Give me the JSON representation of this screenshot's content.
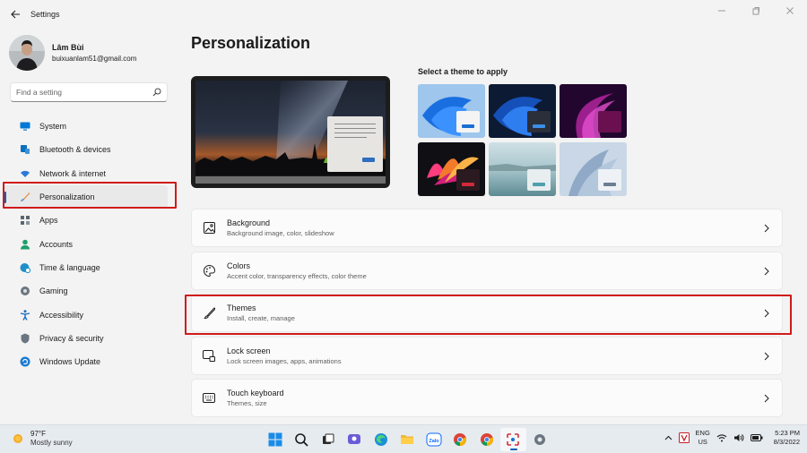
{
  "window": {
    "title": "Settings",
    "back_icon": "back-arrow-icon"
  },
  "profile": {
    "name": "Lâm Bùi",
    "email": "buixuanlam51@gmail.com"
  },
  "search": {
    "placeholder": "Find a setting",
    "icon": "search-icon"
  },
  "sidebar": {
    "items": [
      {
        "label": "System",
        "icon": "system-icon",
        "color": "#0078d4"
      },
      {
        "label": "Bluetooth & devices",
        "icon": "bluetooth-icon",
        "color": "#0a6fbd"
      },
      {
        "label": "Network & internet",
        "icon": "wifi-icon",
        "color": "#2a7ad8"
      },
      {
        "label": "Personalization",
        "icon": "brush-icon",
        "color": "#c46a2b",
        "selected": true
      },
      {
        "label": "Apps",
        "icon": "apps-icon",
        "color": "#5b6670"
      },
      {
        "label": "Accounts",
        "icon": "accounts-icon",
        "color": "#1e9f6a"
      },
      {
        "label": "Time & language",
        "icon": "globe-clock-icon",
        "color": "#1e8fc9"
      },
      {
        "label": "Gaming",
        "icon": "gaming-icon",
        "color": "#6c7680"
      },
      {
        "label": "Accessibility",
        "icon": "accessibility-icon",
        "color": "#1a6fc0"
      },
      {
        "label": "Privacy & security",
        "icon": "shield-icon",
        "color": "#6c7680"
      },
      {
        "label": "Windows Update",
        "icon": "update-icon",
        "color": "#1a7bd1"
      }
    ]
  },
  "main": {
    "title": "Personalization",
    "themes_heading": "Select a theme to apply",
    "themes": [
      {
        "name": "windows-light-theme"
      },
      {
        "name": "windows-dark-theme"
      },
      {
        "name": "glow-theme"
      },
      {
        "name": "captured-motion-theme"
      },
      {
        "name": "sunrise-theme"
      },
      {
        "name": "flow-theme"
      }
    ],
    "cards": [
      {
        "title": "Background",
        "subtitle": "Background image, color, slideshow",
        "icon": "image-icon"
      },
      {
        "title": "Colors",
        "subtitle": "Accent color, transparency effects, color theme",
        "icon": "palette-icon"
      },
      {
        "title": "Themes",
        "subtitle": "Install, create, manage",
        "icon": "brush-icon"
      },
      {
        "title": "Lock screen",
        "subtitle": "Lock screen images, apps, animations",
        "icon": "lock-screen-icon"
      },
      {
        "title": "Touch keyboard",
        "subtitle": "Themes, size",
        "icon": "keyboard-icon"
      }
    ]
  },
  "taskbar": {
    "weather_temp": "97°F",
    "weather_desc": "Mostly sunny",
    "apps": [
      "start-icon",
      "search-icon",
      "task-view-icon",
      "chat-icon",
      "edge-icon",
      "file-explorer-icon",
      "zalo-icon",
      "chrome-icon",
      "chrome-alt-icon",
      "snipping-tool-icon",
      "settings-icon"
    ],
    "zalo_label": "Zalo",
    "lang_top": "ENG",
    "lang_bottom": "US",
    "time": "5:23 PM",
    "date": "8/3/2022"
  },
  "colors": {
    "accent": "#005fb8",
    "highlight_box": "#d11a1a"
  }
}
